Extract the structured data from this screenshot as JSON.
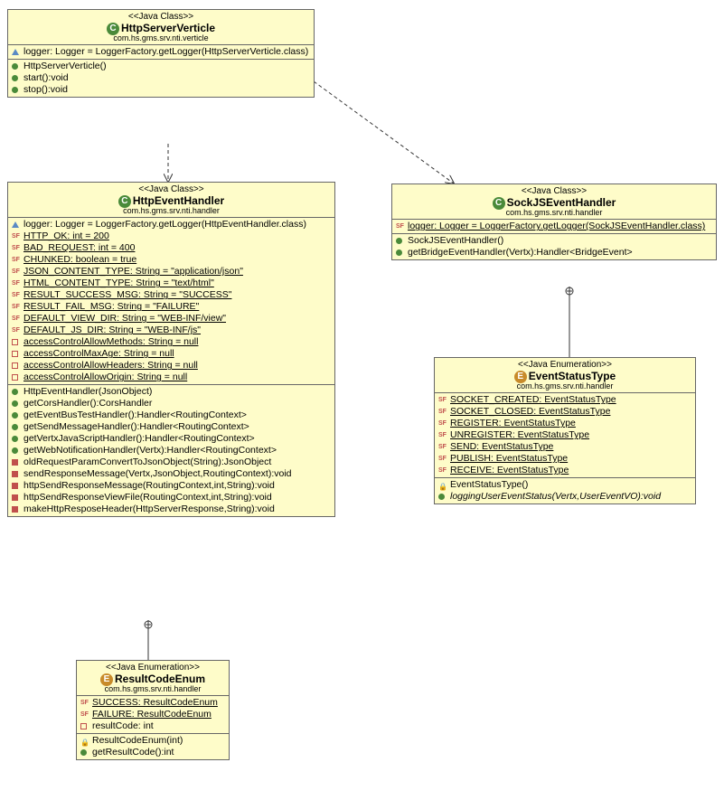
{
  "classes": {
    "httpServerVerticle": {
      "stereotype": "<<Java Class>>",
      "name": "HttpServerVerticle",
      "icon": "C",
      "package": "com.hs.gms.srv.nti.verticle",
      "attrs": [
        {
          "icon": "triangle",
          "text": "logger: Logger = LoggerFactory.getLogger(HttpServerVerticle.class)"
        }
      ],
      "ops": [
        {
          "icon": "green",
          "text": "HttpServerVerticle()"
        },
        {
          "icon": "green",
          "text": "start():void"
        },
        {
          "icon": "green",
          "text": "stop():void"
        }
      ]
    },
    "httpEventHandler": {
      "stereotype": "<<Java Class>>",
      "name": "HttpEventHandler",
      "icon": "C",
      "package": "com.hs.gms.srv.nti.handler",
      "attrs": [
        {
          "icon": "triangle",
          "text": "logger: Logger = LoggerFactory.getLogger(HttpEventHandler.class)"
        },
        {
          "icon": "sf",
          "text": "HTTP_OK: int = 200",
          "underline": true
        },
        {
          "icon": "sf",
          "text": "BAD_REQUEST: int = 400",
          "underline": true
        },
        {
          "icon": "sf",
          "text": "CHUNKED: boolean = true",
          "underline": true
        },
        {
          "icon": "sf",
          "text": "JSON_CONTENT_TYPE: String = \"application/json\"",
          "underline": true
        },
        {
          "icon": "sf",
          "text": "HTML_CONTENT_TYPE: String = \"text/html\"",
          "underline": true
        },
        {
          "icon": "sf",
          "text": "RESULT_SUCCESS_MSG: String = \"SUCCESS\"",
          "underline": true
        },
        {
          "icon": "sf",
          "text": "RESULT_FAIL_MSG: String = \"FAILURE\"",
          "underline": true
        },
        {
          "icon": "sf",
          "text": "DEFAULT_VIEW_DIR: String = \"WEB-INF/view\"",
          "underline": true
        },
        {
          "icon": "sf",
          "text": "DEFAULT_JS_DIR: String = \"WEB-INF/js\"",
          "underline": true
        },
        {
          "icon": "red-sq",
          "text": "accessControlAllowMethods: String = null",
          "underline": true
        },
        {
          "icon": "red-sq",
          "text": "accessControlMaxAge: String = null",
          "underline": true
        },
        {
          "icon": "red-sq",
          "text": "accessControlAllowHeaders: String = null",
          "underline": true
        },
        {
          "icon": "red-sq",
          "text": "accessControlAllowOrigin: String = null",
          "underline": true
        }
      ],
      "ops": [
        {
          "icon": "green",
          "text": "HttpEventHandler(JsonObject)"
        },
        {
          "icon": "green",
          "text": "getCorsHandler():CorsHandler"
        },
        {
          "icon": "green",
          "text": "getEventBusTestHandler():Handler<RoutingContext>"
        },
        {
          "icon": "green",
          "text": "getSendMessageHandler():Handler<RoutingContext>"
        },
        {
          "icon": "green",
          "text": "getVertxJavaScriptHandler():Handler<RoutingContext>"
        },
        {
          "icon": "green",
          "text": "getWebNotificationHandler(Vertx):Handler<RoutingContext>"
        },
        {
          "icon": "red",
          "text": "oldRequestParamConvertToJsonObject(String):JsonObject"
        },
        {
          "icon": "red",
          "text": "sendResponseMessage(Vertx,JsonObject,RoutingContext):void"
        },
        {
          "icon": "red",
          "text": "httpSendResponseMessage(RoutingContext,int,String):void"
        },
        {
          "icon": "red",
          "text": "httpSendResponseViewFile(RoutingContext,int,String):void"
        },
        {
          "icon": "red",
          "text": "makeHttpResposeHeader(HttpServerResponse,String):void"
        }
      ]
    },
    "resultCodeEnum": {
      "stereotype": "<<Java Enumeration>>",
      "name": "ResultCodeEnum",
      "icon": "E",
      "package": "com.hs.gms.srv.nti.handler",
      "attrs": [
        {
          "icon": "sf",
          "text": "SUCCESS: ResultCodeEnum",
          "underline": true
        },
        {
          "icon": "sf",
          "text": "FAILURE: ResultCodeEnum",
          "underline": true
        },
        {
          "icon": "red-sq",
          "text": "resultCode: int"
        }
      ],
      "ops": [
        {
          "icon": "red-lock",
          "text": "ResultCodeEnum(int)"
        },
        {
          "icon": "green",
          "text": "getResultCode():int"
        }
      ]
    },
    "sockJSEventHandler": {
      "stereotype": "<<Java Class>>",
      "name": "SockJSEventHandler",
      "icon": "C",
      "package": "com.hs.gms.srv.nti.handler",
      "attrs": [
        {
          "icon": "sf",
          "text": "logger: Logger = LoggerFactory.getLogger(SockJSEventHandler.class)",
          "underline": true
        }
      ],
      "ops": [
        {
          "icon": "green",
          "text": "SockJSEventHandler()"
        },
        {
          "icon": "green",
          "text": "getBridgeEventHandler(Vertx):Handler<BridgeEvent>"
        }
      ]
    },
    "eventStatusType": {
      "stereotype": "<<Java Enumeration>>",
      "name": "EventStatusType",
      "icon": "E",
      "package": "com.hs.gms.srv.nti.handler",
      "attrs": [
        {
          "icon": "sf",
          "text": "SOCKET_CREATED: EventStatusType",
          "underline": true
        },
        {
          "icon": "sf",
          "text": "SOCKET_CLOSED: EventStatusType",
          "underline": true
        },
        {
          "icon": "sf",
          "text": "REGISTER: EventStatusType",
          "underline": true
        },
        {
          "icon": "sf",
          "text": "UNREGISTER: EventStatusType",
          "underline": true
        },
        {
          "icon": "sf",
          "text": "SEND: EventStatusType",
          "underline": true
        },
        {
          "icon": "sf",
          "text": "PUBLISH: EventStatusType",
          "underline": true
        },
        {
          "icon": "sf",
          "text": "RECEIVE: EventStatusType",
          "underline": true
        }
      ],
      "ops": [
        {
          "icon": "red-lock",
          "text": "EventStatusType()"
        },
        {
          "icon": "green",
          "text": "loggingUserEventStatus(Vertx,UserEventVO):void",
          "italic": true
        }
      ]
    }
  }
}
